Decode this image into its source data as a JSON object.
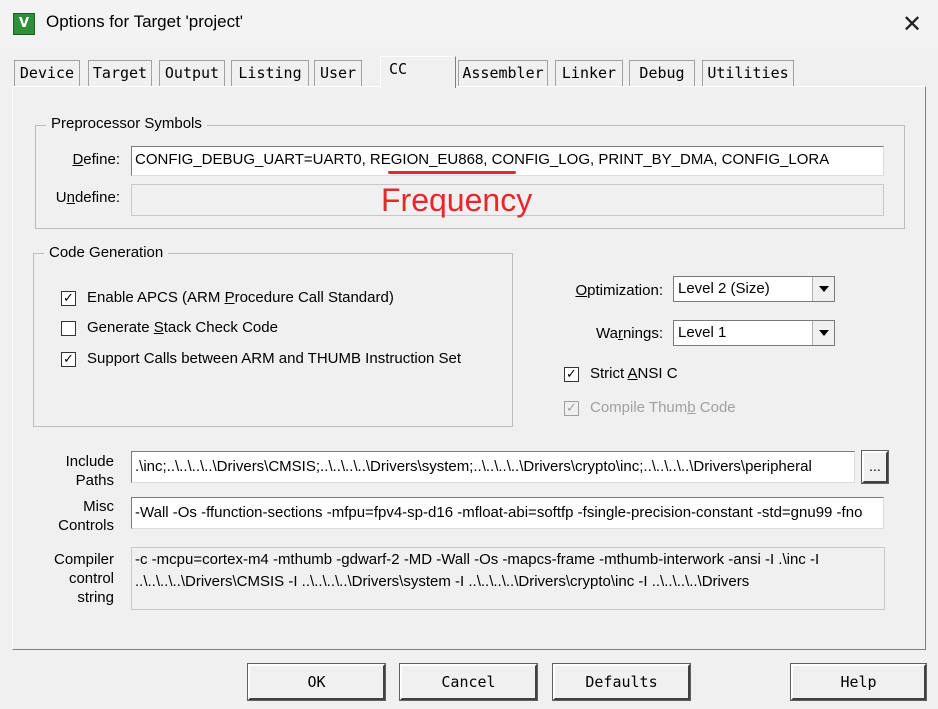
{
  "window": {
    "title": "Options for Target 'project'",
    "icon_letter": "V"
  },
  "tabs": [
    {
      "label": "Device"
    },
    {
      "label": "Target"
    },
    {
      "label": "Output"
    },
    {
      "label": "Listing"
    },
    {
      "label": "User"
    },
    {
      "label": "CC"
    },
    {
      "label": "Assembler"
    },
    {
      "label": "Linker"
    },
    {
      "label": "Debug"
    },
    {
      "label": "Utilities"
    }
  ],
  "preprocessor": {
    "group_title": "Preprocessor Symbols",
    "define_label_key": "D",
    "define_label_rest": "efine:",
    "define_value": "CONFIG_DEBUG_UART=UART0,  REGION_EU868,  CONFIG_LOG,  PRINT_BY_DMA, CONFIG_LORA",
    "undefine_label_pre": "U",
    "undefine_label_key": "n",
    "undefine_label_rest": "define:",
    "undefine_value": ""
  },
  "annotation": {
    "text": "Frequency",
    "color": "#e8262c"
  },
  "code_generation": {
    "group_title": "Code Generation",
    "options": [
      {
        "pre": "Enable APCS (ARM ",
        "key": "P",
        "post": "rocedure Call Standard)",
        "checked": true,
        "check": "✓"
      },
      {
        "pre": "Generate ",
        "key": "S",
        "post": "tack Check Code",
        "checked": false,
        "check": ""
      },
      {
        "pre": "Support Calls between ARM and THUMB Instruction Set",
        "key": "",
        "post": "",
        "checked": true,
        "check": "✓"
      }
    ]
  },
  "optimization": {
    "label_key": "O",
    "label_rest": "ptimization:",
    "value": "Level 2 (Size)"
  },
  "warnings": {
    "label_pre": "Wa",
    "label_key": "r",
    "label_rest": "nings:",
    "value": "Level 1"
  },
  "strict_ansi": {
    "pre": "Strict ",
    "key": "A",
    "post": "NSI C",
    "checked": true,
    "check": "✓"
  },
  "compile_thumb": {
    "pre": "Compile Thum",
    "key": "b",
    "post": " Code",
    "checked": true,
    "check": "✓",
    "disabled": true
  },
  "include_paths": {
    "label_line1": "Include",
    "label_line2": "Paths",
    "value": ".\\inc;..\\..\\..\\..\\Drivers\\CMSIS;..\\..\\..\\..\\Drivers\\system;..\\..\\..\\..\\Drivers\\crypto\\inc;..\\..\\..\\..\\Drivers\\peripheral",
    "browse_label": "..."
  },
  "misc_controls": {
    "label_line1": "Misc",
    "label_line2": "Controls",
    "value": "-Wall -Os -ffunction-sections -mfpu=fpv4-sp-d16 -mfloat-abi=softfp -fsingle-precision-constant -std=gnu99 -fno"
  },
  "compiler_control": {
    "label_line1": "Compiler",
    "label_line2": "control",
    "label_line3": "string",
    "value": "-c -mcpu=cortex-m4 -mthumb -gdwarf-2 -MD -Wall -Os -mapcs-frame -mthumb-interwork -ansi -I .\\inc -I ..\\..\\..\\..\\Drivers\\CMSIS -I ..\\..\\..\\..\\Drivers\\system -I ..\\..\\..\\..\\Drivers\\crypto\\inc -I ..\\..\\..\\..\\Drivers"
  },
  "buttons": {
    "ok": "OK",
    "cancel": "Cancel",
    "defaults": "Defaults",
    "help": "Help"
  }
}
